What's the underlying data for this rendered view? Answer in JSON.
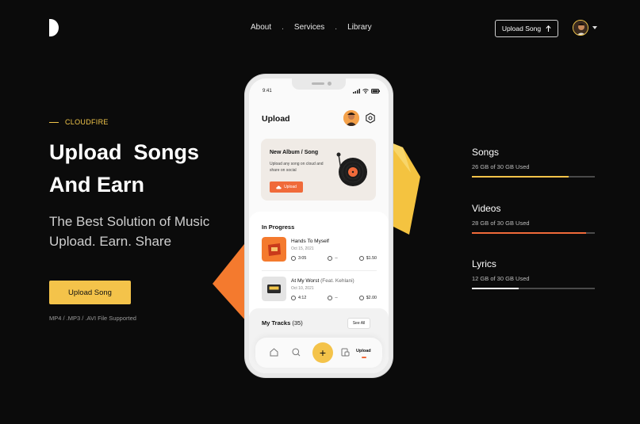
{
  "header": {
    "nav": [
      "About",
      "Services",
      "Library"
    ],
    "nav_separator": ".",
    "upload_button": "Upload Song",
    "upload_icon": "arrow-up-icon"
  },
  "hero": {
    "eyebrow": "CLOUDFIRE",
    "title_line1": "Upload  Songs",
    "title_line2": "And Earn",
    "subtitle_line1": "The Best Solution of Music",
    "subtitle_line2": "Upload. Earn. Share",
    "cta": "Upload Song",
    "formats": "MP4 / .MP3 / .AVI File Supported"
  },
  "phone": {
    "time": "9:41",
    "title": "Upload",
    "card": {
      "title": "New Album / Song",
      "description": "Upload any song on cloud and share on social",
      "button": "Upload"
    },
    "in_progress_title": "In Progress",
    "tracks": [
      {
        "name": "Hands To Myself",
        "feat": "",
        "date": "Oct 15, 2021",
        "duration": "3:05",
        "plays": "--",
        "price": "$1.50"
      },
      {
        "name": "At My Worst",
        "feat": "(Feat. Kehlani)",
        "date": "Oct 10, 2021",
        "duration": "4:12",
        "plays": "--",
        "price": "$2.00"
      }
    ],
    "my_tracks_title": "My Tracks",
    "my_tracks_count": "(35)",
    "see_all": "See All",
    "tab_active": "Upload",
    "fab": "+"
  },
  "storage": [
    {
      "label": "Songs",
      "usage": "26 GB of 30 GB Used",
      "used_fraction": 0.79,
      "color": "#f4c34a"
    },
    {
      "label": "Videos",
      "usage": "28 GB of 30 GB Used",
      "used_fraction": 0.93,
      "color": "#f06a3a"
    },
    {
      "label": "Lyrics",
      "usage": "12 GB of 30 GB Used",
      "used_fraction": 0.38,
      "color": "#ffffff"
    }
  ],
  "colors": {
    "accent_yellow": "#f4c34a",
    "accent_orange": "#f06a3a",
    "background": "#0b0b0b"
  }
}
